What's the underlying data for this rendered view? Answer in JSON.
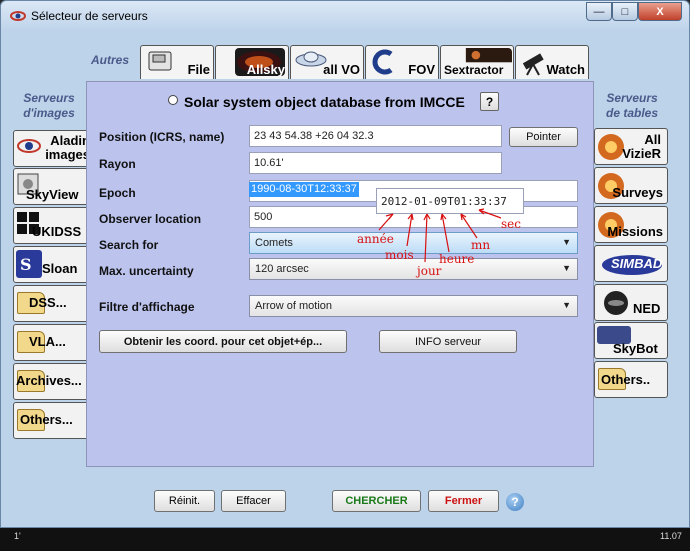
{
  "window": {
    "title": "Sélecteur de serveurs",
    "minimize": "—",
    "maximize": "□",
    "close": "X"
  },
  "left_header": "Autres",
  "left_sub": "Serveurs d'images",
  "right_sub": "Serveurs de tables",
  "top_tabs": [
    {
      "label": "File",
      "icon": "file-icon"
    },
    {
      "label": "Allsky",
      "icon": "allsky-icon"
    },
    {
      "label": "all VO",
      "icon": "vo-icon"
    },
    {
      "label": "FOV",
      "icon": "fov-icon"
    },
    {
      "label": "Sextractor",
      "icon": "sextractor-icon"
    },
    {
      "label": "Watch",
      "icon": "telescope-icon"
    }
  ],
  "left_servers": [
    {
      "label": "Aladin images",
      "icon": "aladin-icon"
    },
    {
      "label": "SkyView",
      "icon": "skyview-icon"
    },
    {
      "label": "UKIDSS",
      "icon": "ukidss-icon"
    },
    {
      "label": "Sloan",
      "icon": "sloan-icon"
    },
    {
      "label": "DSS...",
      "icon": "folder-icon"
    },
    {
      "label": "VLA...",
      "icon": "folder-icon"
    },
    {
      "label": "Archives...",
      "icon": "folder-icon"
    },
    {
      "label": "Others...",
      "icon": "folder-icon"
    }
  ],
  "right_servers": [
    {
      "label": "All VizieR",
      "icon": "vizier-icon"
    },
    {
      "label": "Surveys",
      "icon": "surveys-icon"
    },
    {
      "label": "Missions",
      "icon": "missions-icon"
    },
    {
      "label": "SIMBAD",
      "icon": "simbad-icon"
    },
    {
      "label": "NED",
      "icon": "ned-icon"
    },
    {
      "label": "SkyBot",
      "icon": "skybot-icon"
    },
    {
      "label": "Others..",
      "icon": "folder-icon"
    }
  ],
  "form": {
    "title": "Solar system object database from IMCCE",
    "help": "?",
    "position_label": "Position (ICRS, name)",
    "position_value": "23 43 54.38 +26 04 32.3",
    "pointer_button": "Pointer",
    "radius_label": "Rayon",
    "radius_value": "10.61'",
    "epoch_label": "Epoch",
    "epoch_value": "1990-08-30T12:33:37",
    "epoch_example": "2012-01-09T01:33:37",
    "observer_label": "Observer location",
    "observer_value": "500",
    "search_label": "Search for",
    "search_value": "Comets",
    "uncertainty_label": "Max. uncertainty",
    "uncertainty_value": "120 arcsec",
    "filter_label": "Filtre d'affichage",
    "filter_value": "Arrow of motion",
    "get_coords_button": "Obtenir les coord. pour cet objet+ép...",
    "info_button": "INFO serveur"
  },
  "annotations": {
    "year": "année",
    "month": "mois",
    "day": "jour",
    "hour": "heure",
    "minute": "mn",
    "second": "sec"
  },
  "bottom": {
    "reset": "Réinit.",
    "clear": "Effacer",
    "search": "CHERCHER",
    "close": "Fermer",
    "help": "?"
  },
  "status": {
    "left_coord": "1'",
    "right_coord": "11.07"
  },
  "colors": {
    "panel": "#bcc4ee",
    "search_green": "#1a7a1a",
    "close_red": "#cc1111",
    "annotation_red": "#d81010"
  }
}
